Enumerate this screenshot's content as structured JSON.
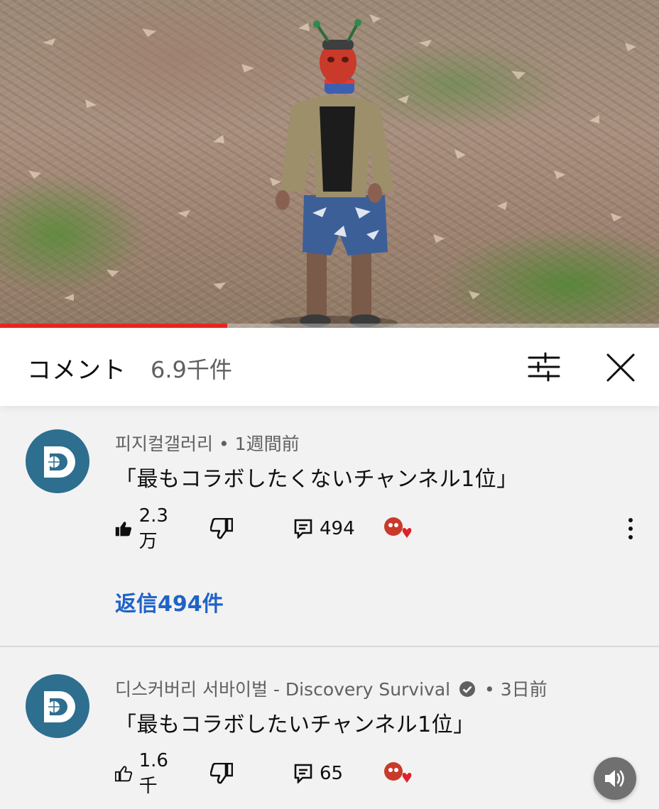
{
  "video": {
    "progress_fraction": 0.345,
    "progress_color": "#e8261f"
  },
  "header": {
    "title": "コメント",
    "count": "6.9千件",
    "filter_icon": "filter-sliders-icon",
    "close_icon": "close-icon"
  },
  "comments": [
    {
      "author": "피지컬갤러리",
      "time": "1週間前",
      "text": "「最もコラボしたくないチャンネル1位」",
      "likes": "2.3万",
      "replies_count": "494",
      "liked": true,
      "replies_link": "返信494件"
    },
    {
      "author": "디스커버리 서바이벌 - Discovery Survival",
      "time": "3日前",
      "text": "「最もコラボしたいチャンネル1位」",
      "likes": "1.6千",
      "replies_count": "65",
      "liked": false,
      "verified": true
    }
  ],
  "separator": "•",
  "colors": {
    "avatar_bg": "#2e6e8f",
    "link": "#1f63c7",
    "heart": "#e0202a"
  }
}
